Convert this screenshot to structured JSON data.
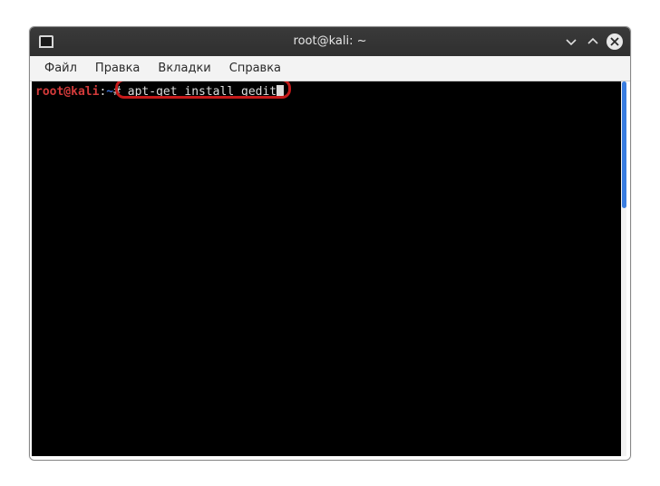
{
  "window": {
    "title": "root@kali: ~"
  },
  "menu": {
    "file": "Файл",
    "edit": "Правка",
    "tabs": "Вкладки",
    "help": "Справка"
  },
  "prompt": {
    "user_host": "root@kali",
    "separator": ":",
    "path": "~",
    "symbol": "#"
  },
  "command": {
    "text": "apt-get install gedit"
  }
}
